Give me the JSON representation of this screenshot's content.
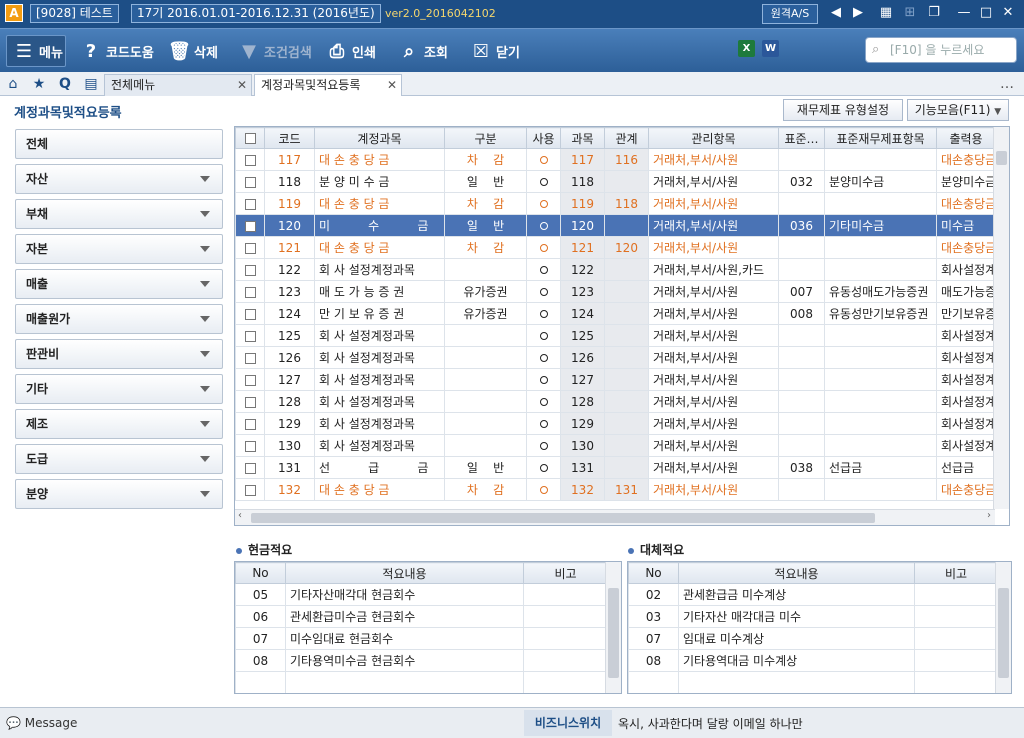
{
  "titlebar": {
    "company": "[9028] 테스트",
    "period": "17기 2016.01.01-2016.12.31 (2016년도)",
    "version": "ver2.0_2016042102",
    "remote": "원격A/S",
    "logo": "A"
  },
  "toolbar": {
    "menu": "메뉴",
    "code_help": "코드도움",
    "delete": "삭제",
    "condition_search": "조건검색",
    "print": "인쇄",
    "lookup": "조회",
    "close": "닫기",
    "search_placeholder": "[F10] 을 누르세요"
  },
  "tabs": {
    "all_menu": "전체메뉴",
    "active": "계정과목및적요등록"
  },
  "page": {
    "title": "계정과목및적요등록",
    "fin_btn": "재무제표 유형설정",
    "func_btn": "기능모음(F11)"
  },
  "categories": [
    {
      "label": "전체",
      "arrow": false
    },
    {
      "label": "자산",
      "arrow": true
    },
    {
      "label": "부채",
      "arrow": true
    },
    {
      "label": "자본",
      "arrow": true
    },
    {
      "label": "매출",
      "arrow": true
    },
    {
      "label": "매출원가",
      "arrow": true
    },
    {
      "label": "판관비",
      "arrow": true
    },
    {
      "label": "기타",
      "arrow": true
    },
    {
      "label": "제조",
      "arrow": true
    },
    {
      "label": "도급",
      "arrow": true
    },
    {
      "label": "분양",
      "arrow": true
    }
  ],
  "main_grid": {
    "headers": [
      "",
      "코드",
      "계정과목",
      "구분",
      "사용",
      "과목",
      "관계",
      "관리항목",
      "표준…",
      "표준재무제표항목",
      "출력용"
    ],
    "rows": [
      {
        "style": "orange",
        "code": "117",
        "name": "대 손 충 당 금",
        "type": "차    감",
        "use": "ring",
        "subj": "117",
        "rel": "116",
        "mgmt": "거래처,부서/사원",
        "std": "",
        "stdname": "",
        "print": "대손충당금"
      },
      {
        "style": "",
        "code": "118",
        "name": "분 양 미 수 금",
        "type": "일    반",
        "use": "ring",
        "subj": "118",
        "rel": "",
        "mgmt": "거래처,부서/사원",
        "std": "032",
        "stdname": "분양미수금",
        "print": "분양미수금"
      },
      {
        "style": "orange",
        "code": "119",
        "name": "대 손 충 당 금",
        "type": "차    감",
        "use": "ring",
        "subj": "119",
        "rel": "118",
        "mgmt": "거래처,부서/사원",
        "std": "",
        "stdname": "",
        "print": "대손충당금"
      },
      {
        "style": "sel",
        "code": "120",
        "name": "미          수          금",
        "type": "일    반",
        "use": "ring",
        "subj": "120",
        "rel": "",
        "mgmt": "거래처,부서/사원",
        "std": "036",
        "stdname": "기타미수금",
        "print": "미수금"
      },
      {
        "style": "orange",
        "code": "121",
        "name": "대 손 충 당 금",
        "type": "차    감",
        "use": "ring",
        "subj": "121",
        "rel": "120",
        "mgmt": "거래처,부서/사원",
        "std": "",
        "stdname": "",
        "print": "대손충당금"
      },
      {
        "style": "",
        "code": "122",
        "name": "회 사 설정계정과목",
        "type": "",
        "use": "ring",
        "subj": "122",
        "rel": "",
        "mgmt": "거래처,부서/사원,카드",
        "std": "",
        "stdname": "",
        "print": "회사설정계"
      },
      {
        "style": "",
        "code": "123",
        "name": "매 도 가 능 증 권",
        "type": "유가증권",
        "use": "ring",
        "subj": "123",
        "rel": "",
        "mgmt": "거래처,부서/사원",
        "std": "007",
        "stdname": "유동성매도가능증권",
        "print": "매도가능증"
      },
      {
        "style": "",
        "code": "124",
        "name": "만 기 보 유 증 권",
        "type": "유가증권",
        "use": "ring",
        "subj": "124",
        "rel": "",
        "mgmt": "거래처,부서/사원",
        "std": "008",
        "stdname": "유동성만기보유증권",
        "print": "만기보유증"
      },
      {
        "style": "",
        "code": "125",
        "name": "회 사 설정계정과목",
        "type": "",
        "use": "ring",
        "subj": "125",
        "rel": "",
        "mgmt": "거래처,부서/사원",
        "std": "",
        "stdname": "",
        "print": "회사설정계"
      },
      {
        "style": "",
        "code": "126",
        "name": "회 사 설정계정과목",
        "type": "",
        "use": "ring",
        "subj": "126",
        "rel": "",
        "mgmt": "거래처,부서/사원",
        "std": "",
        "stdname": "",
        "print": "회사설정계"
      },
      {
        "style": "",
        "code": "127",
        "name": "회 사 설정계정과목",
        "type": "",
        "use": "ring",
        "subj": "127",
        "rel": "",
        "mgmt": "거래처,부서/사원",
        "std": "",
        "stdname": "",
        "print": "회사설정계"
      },
      {
        "style": "",
        "code": "128",
        "name": "회 사 설정계정과목",
        "type": "",
        "use": "ring",
        "subj": "128",
        "rel": "",
        "mgmt": "거래처,부서/사원",
        "std": "",
        "stdname": "",
        "print": "회사설정계"
      },
      {
        "style": "",
        "code": "129",
        "name": "회 사 설정계정과목",
        "type": "",
        "use": "ring",
        "subj": "129",
        "rel": "",
        "mgmt": "거래처,부서/사원",
        "std": "",
        "stdname": "",
        "print": "회사설정계"
      },
      {
        "style": "",
        "code": "130",
        "name": "회 사 설정계정과목",
        "type": "",
        "use": "ring",
        "subj": "130",
        "rel": "",
        "mgmt": "거래처,부서/사원",
        "std": "",
        "stdname": "",
        "print": "회사설정계"
      },
      {
        "style": "",
        "code": "131",
        "name": "선          급          금",
        "type": "일    반",
        "use": "ring",
        "subj": "131",
        "rel": "",
        "mgmt": "거래처,부서/사원",
        "std": "038",
        "stdname": "선급금",
        "print": "선급금"
      },
      {
        "style": "orange",
        "code": "132",
        "name": "대 손 충 당 금",
        "type": "차    감",
        "use": "ring",
        "subj": "132",
        "rel": "131",
        "mgmt": "거래처,부서/사원",
        "std": "",
        "stdname": "",
        "print": "대손충당금"
      }
    ]
  },
  "cash": {
    "title": "현금적요",
    "headers": [
      "No",
      "적요내용",
      "비고"
    ],
    "rows": [
      {
        "no": "05",
        "text": "기타자산매각대 현금회수",
        "note": ""
      },
      {
        "no": "06",
        "text": "관세환급미수금 현금회수",
        "note": ""
      },
      {
        "no": "07",
        "text": "미수임대료 현금회수",
        "note": ""
      },
      {
        "no": "08",
        "text": "기타용역미수금 현금회수",
        "note": ""
      }
    ]
  },
  "transfer": {
    "title": "대체적요",
    "headers": [
      "No",
      "적요내용",
      "비고"
    ],
    "rows": [
      {
        "no": "02",
        "text": "관세환급금 미수계상",
        "note": ""
      },
      {
        "no": "03",
        "text": "기타자산 매각대금 미수",
        "note": ""
      },
      {
        "no": "07",
        "text": "임대료 미수계상",
        "note": ""
      },
      {
        "no": "08",
        "text": "기타용역대금 미수계상",
        "note": ""
      }
    ]
  },
  "status": {
    "message": "Message",
    "biz_label": "비즈니스위치",
    "biz_text": "옥시, 사과한다며 달랑 이메일 하나만"
  },
  "colors": {
    "orange": "#e07020",
    "selected": "#4a73b5",
    "brand": "#1d4e86"
  }
}
